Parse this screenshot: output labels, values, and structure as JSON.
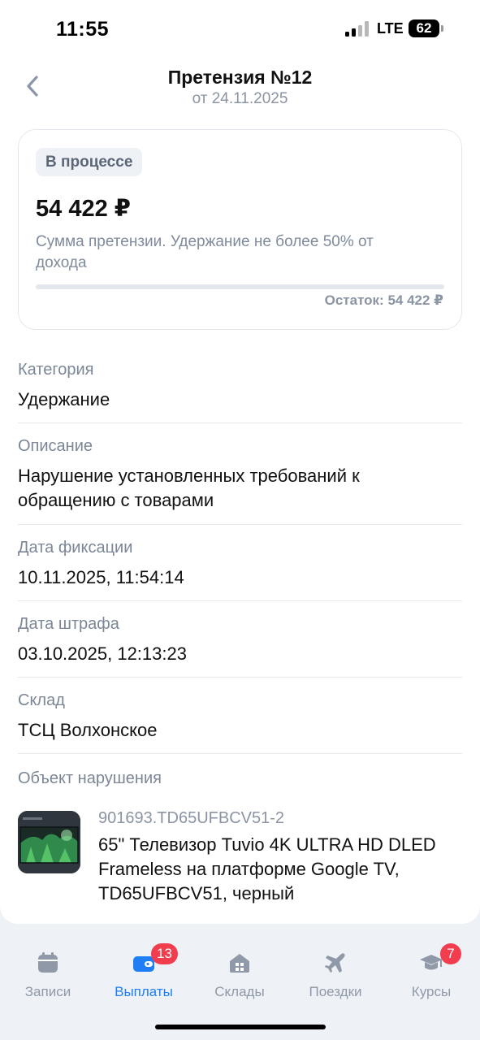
{
  "status_bar": {
    "time": "11:55",
    "network": "LTE",
    "battery": "62"
  },
  "header": {
    "title": "Претензия №12",
    "subtitle": "от 24.11.2025"
  },
  "summary": {
    "status_badge": "В процессе",
    "amount": "54 422 ₽",
    "description": "Сумма претензии. Удержание не более 50% от дохода",
    "progress_fraction": 0.0,
    "remainder": "Остаток: 54 422 ₽"
  },
  "fields": [
    {
      "label": "Категория",
      "value": "Удержание"
    },
    {
      "label": "Описание",
      "value": "Нарушение установленных требований к обращению с товарами"
    },
    {
      "label": "Дата фиксации",
      "value": "10.11.2025, 11:54:14"
    },
    {
      "label": "Дата штрафа",
      "value": "03.10.2025, 12:13:23"
    },
    {
      "label": "Склад",
      "value": "ТСЦ Волхонское"
    }
  ],
  "violation_object": {
    "label": "Объект нарушения",
    "product_code": "901693.TD65UFBCV51-2",
    "product_name": "65\" Телевизор Tuvio 4K ULTRA HD DLED Frameless на платформе Google TV, TD65UFBCV51, черный",
    "thumbnail_icon": "tv-thumbnail"
  },
  "tabbar": {
    "tabs": [
      {
        "label": "Записи",
        "icon": "calendar-icon",
        "active": false,
        "badge": ""
      },
      {
        "label": "Выплаты",
        "icon": "wallet-icon",
        "active": true,
        "badge": "13"
      },
      {
        "label": "Склады",
        "icon": "warehouse-icon",
        "active": false,
        "badge": ""
      },
      {
        "label": "Поездки",
        "icon": "airplane-icon",
        "active": false,
        "badge": ""
      },
      {
        "label": "Курсы",
        "icon": "graduation-cap-icon",
        "active": false,
        "badge": "7"
      }
    ]
  },
  "colors": {
    "accent": "#1f7ef5",
    "badge": "#f23d4f",
    "muted": "#8a94a3"
  }
}
